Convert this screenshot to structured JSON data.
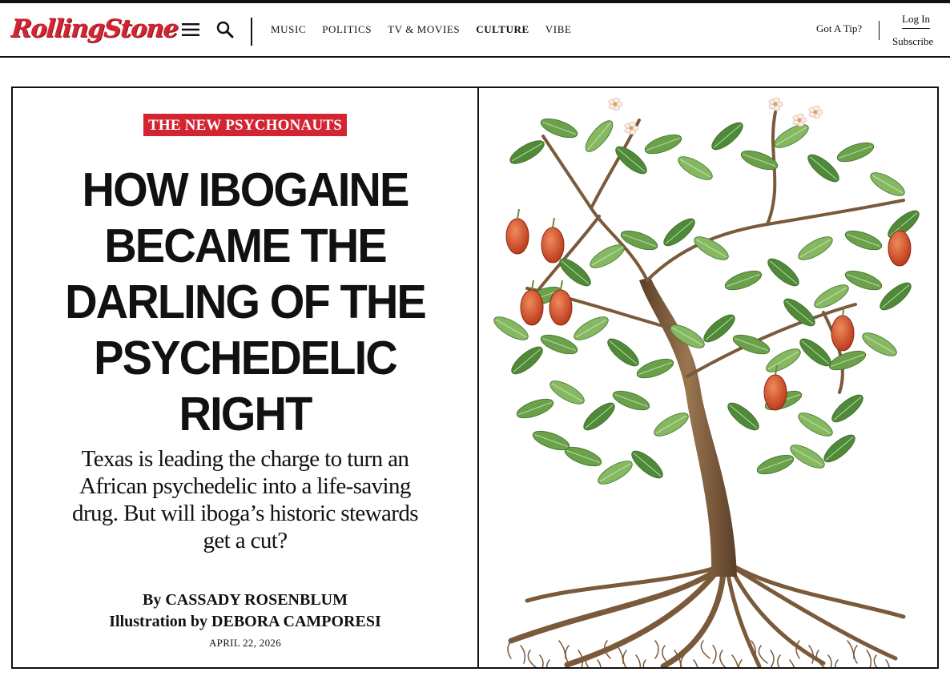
{
  "header": {
    "logo": "RollingStone",
    "nav": [
      "Music",
      "Politics",
      "TV & Movies",
      "Culture",
      "Vibe"
    ],
    "active_nav": "Culture",
    "tip": "Got A Tip?",
    "login": "Log In",
    "subscribe": "Subscribe"
  },
  "article": {
    "kicker": "THE NEW PSYCHONAUTS",
    "headline": "How Ibogaine Became the Darling of the Psychedelic Right",
    "dek": "Texas is leading the charge to turn an African psychedelic into a life-saving drug. But will iboga’s historic stewards get a cut?",
    "byline_author": "By CASSADY ROSENBLUM",
    "byline_illustrator": "Illustration by DEBORA CAMPORESI",
    "date": "APRIL 22, 2026"
  },
  "colors": {
    "brand_red": "#d32531",
    "leaf_green": "#6aa14a",
    "fruit_orange": "#d9552b",
    "trunk_brown": "#7a5a3a"
  },
  "icons": [
    "menu-icon",
    "search-icon"
  ]
}
